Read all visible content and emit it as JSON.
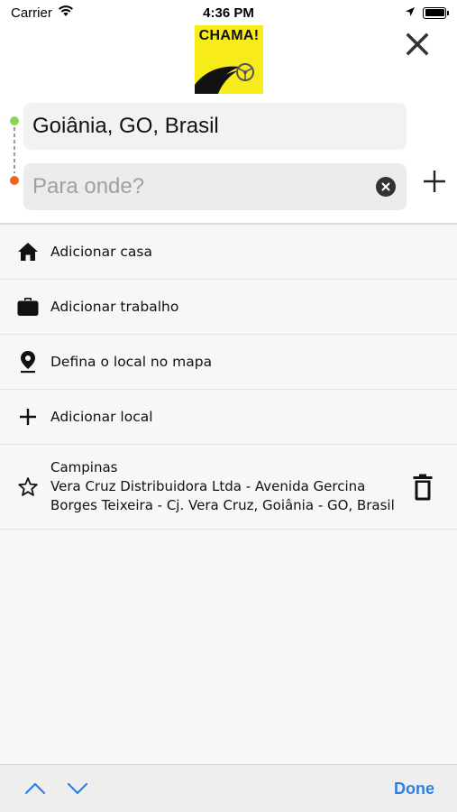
{
  "status_bar": {
    "carrier": "Carrier",
    "time": "4:36 PM",
    "icons": [
      "wifi-icon",
      "location-arrow-icon",
      "battery-icon"
    ]
  },
  "header": {
    "logo_text": "CHAMA!",
    "logo_color": "#f7ec1a",
    "close_icon": "close-icon"
  },
  "route": {
    "origin_value": "Goiânia, GO, Brasil",
    "origin_dot_color": "#8cd35a",
    "destination_placeholder": "Para onde?",
    "destination_value": "",
    "destination_dot_color": "#f0641e"
  },
  "shortcuts": [
    {
      "icon": "home-icon",
      "label": "Adicionar casa"
    },
    {
      "icon": "briefcase-icon",
      "label": "Adicionar trabalho"
    },
    {
      "icon": "map-pin-icon",
      "label": "Defina o local no mapa"
    },
    {
      "icon": "plus-icon",
      "label": "Adicionar local"
    }
  ],
  "saved_places": [
    {
      "icon": "star-outline-icon",
      "name": "Campinas",
      "address": "Vera Cruz Distribuidora Ltda - Avenida Gercina Borges Teixeira - Cj. Vera Cruz, Goiânia - GO, Brasil",
      "delete_icon": "trash-icon"
    }
  ],
  "keyboard_toolbar": {
    "done_label": "Done",
    "accent_color": "#2f7fe0"
  }
}
